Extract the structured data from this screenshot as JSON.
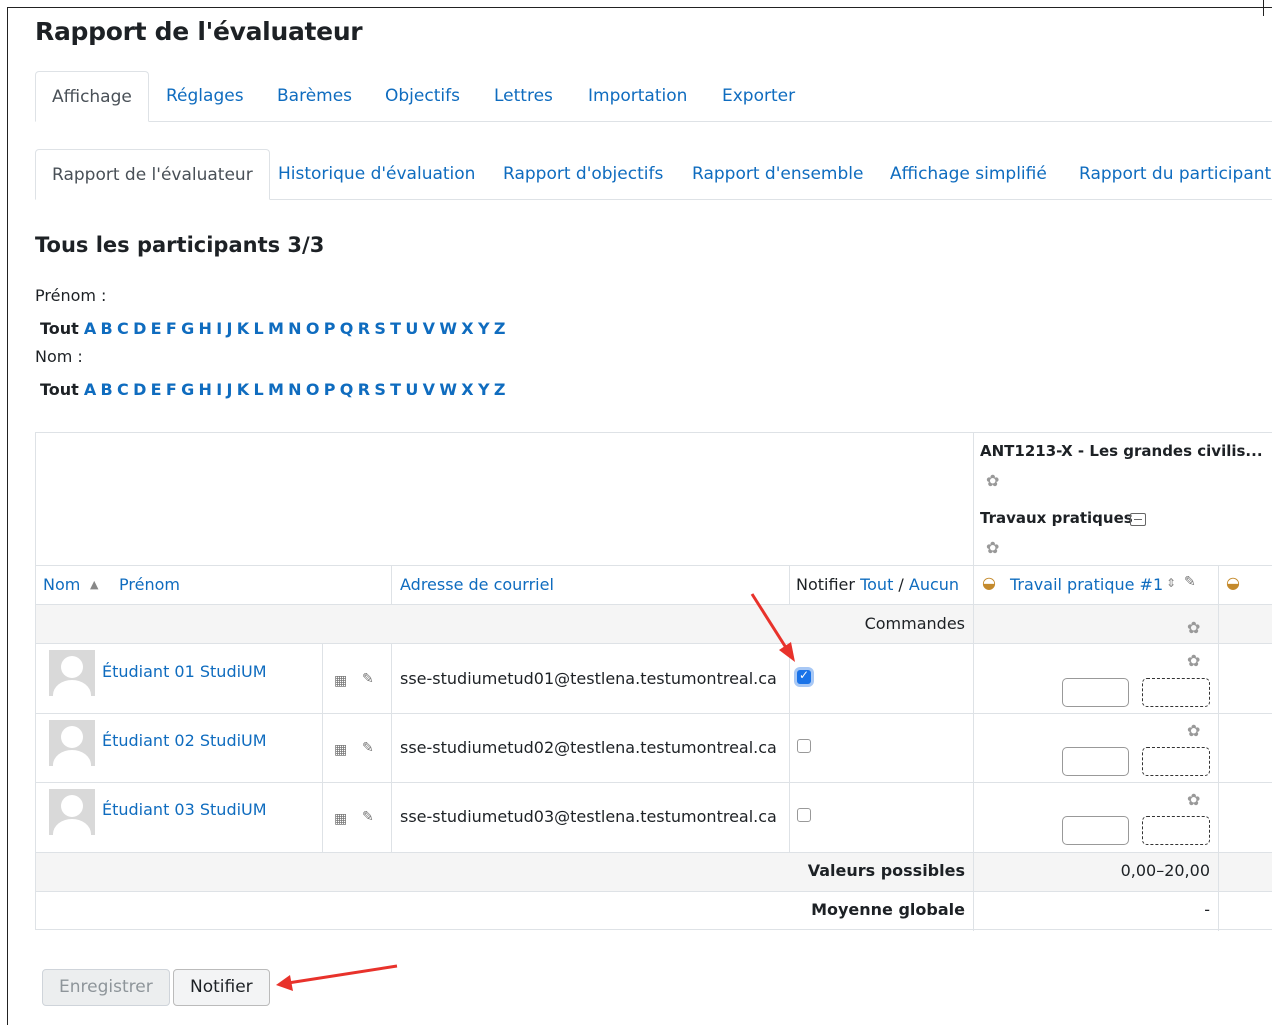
{
  "page": {
    "title": "Rapport de l'évaluateur"
  },
  "tabs_top": [
    {
      "label": "Affichage",
      "active": true
    },
    {
      "label": "Réglages"
    },
    {
      "label": "Barèmes"
    },
    {
      "label": "Objectifs"
    },
    {
      "label": "Lettres"
    },
    {
      "label": "Importation"
    },
    {
      "label": "Exporter"
    }
  ],
  "tabs_sub": [
    {
      "label": "Rapport de l'évaluateur",
      "active": true
    },
    {
      "label": "Historique d'évaluation"
    },
    {
      "label": "Rapport d'objectifs"
    },
    {
      "label": "Rapport d'ensemble"
    },
    {
      "label": "Affichage simplifié"
    },
    {
      "label": "Rapport du participant"
    }
  ],
  "participants": {
    "heading": "Tous les participants 3/3",
    "firstname_label": "Prénom :",
    "lastname_label": "Nom :",
    "all_label": "Tout",
    "letters": [
      "A",
      "B",
      "C",
      "D",
      "E",
      "F",
      "G",
      "H",
      "I",
      "J",
      "K",
      "L",
      "M",
      "N",
      "O",
      "P",
      "Q",
      "R",
      "S",
      "T",
      "U",
      "V",
      "W",
      "X",
      "Y",
      "Z"
    ]
  },
  "grid": {
    "course_header": "ANT1213-X - Les grandes civilis...",
    "category_header": "Travaux pratiques",
    "col_name": "Nom",
    "col_firstname": "Prénom",
    "col_email": "Adresse de courriel",
    "col_notify": "Notifier",
    "notify_all": "Tout",
    "notify_sep": " / ",
    "notify_none": "Aucun",
    "col_item": "Travail pratique #1",
    "controls_label": "Commandes",
    "rows": [
      {
        "name": "Étudiant 01 StudiUM",
        "email": "sse-studiumetud01@testlena.testumontreal.ca",
        "notify": true
      },
      {
        "name": "Étudiant 02 StudiUM",
        "email": "sse-studiumetud02@testlena.testumontreal.ca",
        "notify": false
      },
      {
        "name": "Étudiant 03 StudiUM",
        "email": "sse-studiumetud03@testlena.testumontreal.ca",
        "notify": false
      }
    ],
    "range_label": "Valeurs possibles",
    "range_value": "0,00–20,00",
    "average_label": "Moyenne globale",
    "average_value": "-"
  },
  "buttons": {
    "save": "Enregistrer",
    "notify": "Notifier"
  },
  "colors": {
    "link": "#0f6cbf",
    "arrow": "#e8322b",
    "checkbox": "#1a73e8"
  }
}
